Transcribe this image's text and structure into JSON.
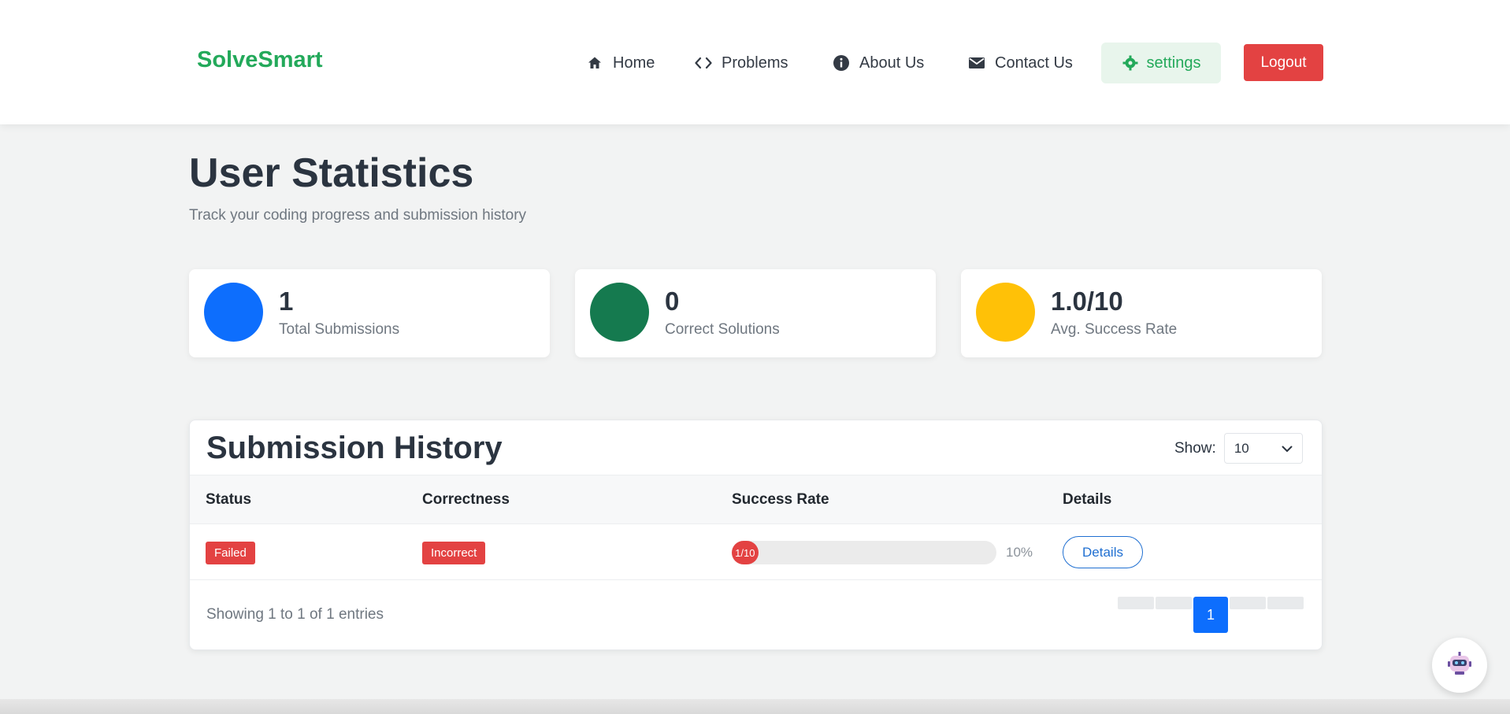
{
  "header": {
    "brand": "SolveSmart",
    "nav": {
      "home": "Home",
      "problems": "Problems",
      "about": "About Us",
      "contact": "Contact Us",
      "settings": "settings"
    },
    "logout": "Logout"
  },
  "page": {
    "title": "User Statistics",
    "subtitle": "Track your coding progress and submission history"
  },
  "stats": [
    {
      "value": "1",
      "label": "Total Submissions",
      "color": "#0d6efd"
    },
    {
      "value": "0",
      "label": "Correct Solutions",
      "color": "#157a4f"
    },
    {
      "value": "1.0/10",
      "label": "Avg. Success Rate",
      "color": "#ffc107"
    }
  ],
  "history": {
    "title": "Submission History",
    "show_label": "Show:",
    "show_value": "10",
    "columns": [
      "Status",
      "Correctness",
      "Success Rate",
      "Details"
    ],
    "rows": [
      {
        "status": "Failed",
        "correctness": "Incorrect",
        "rate_text": "1/10",
        "rate_fraction": 0.1,
        "rate_percent": "10%",
        "details": "Details"
      }
    ],
    "showing": "Showing 1 to 1 of 1 entries",
    "current_page": "1"
  },
  "colors": {
    "brand": "#23a95a",
    "danger": "#e34242",
    "primary": "#0d6efd"
  },
  "icons": {
    "home": "home-icon",
    "problems": "code-icon",
    "about": "info-icon",
    "contact": "envelope-icon",
    "settings": "gear-icon",
    "dropdown": "chevron-down-icon",
    "bot": "robot-icon"
  }
}
